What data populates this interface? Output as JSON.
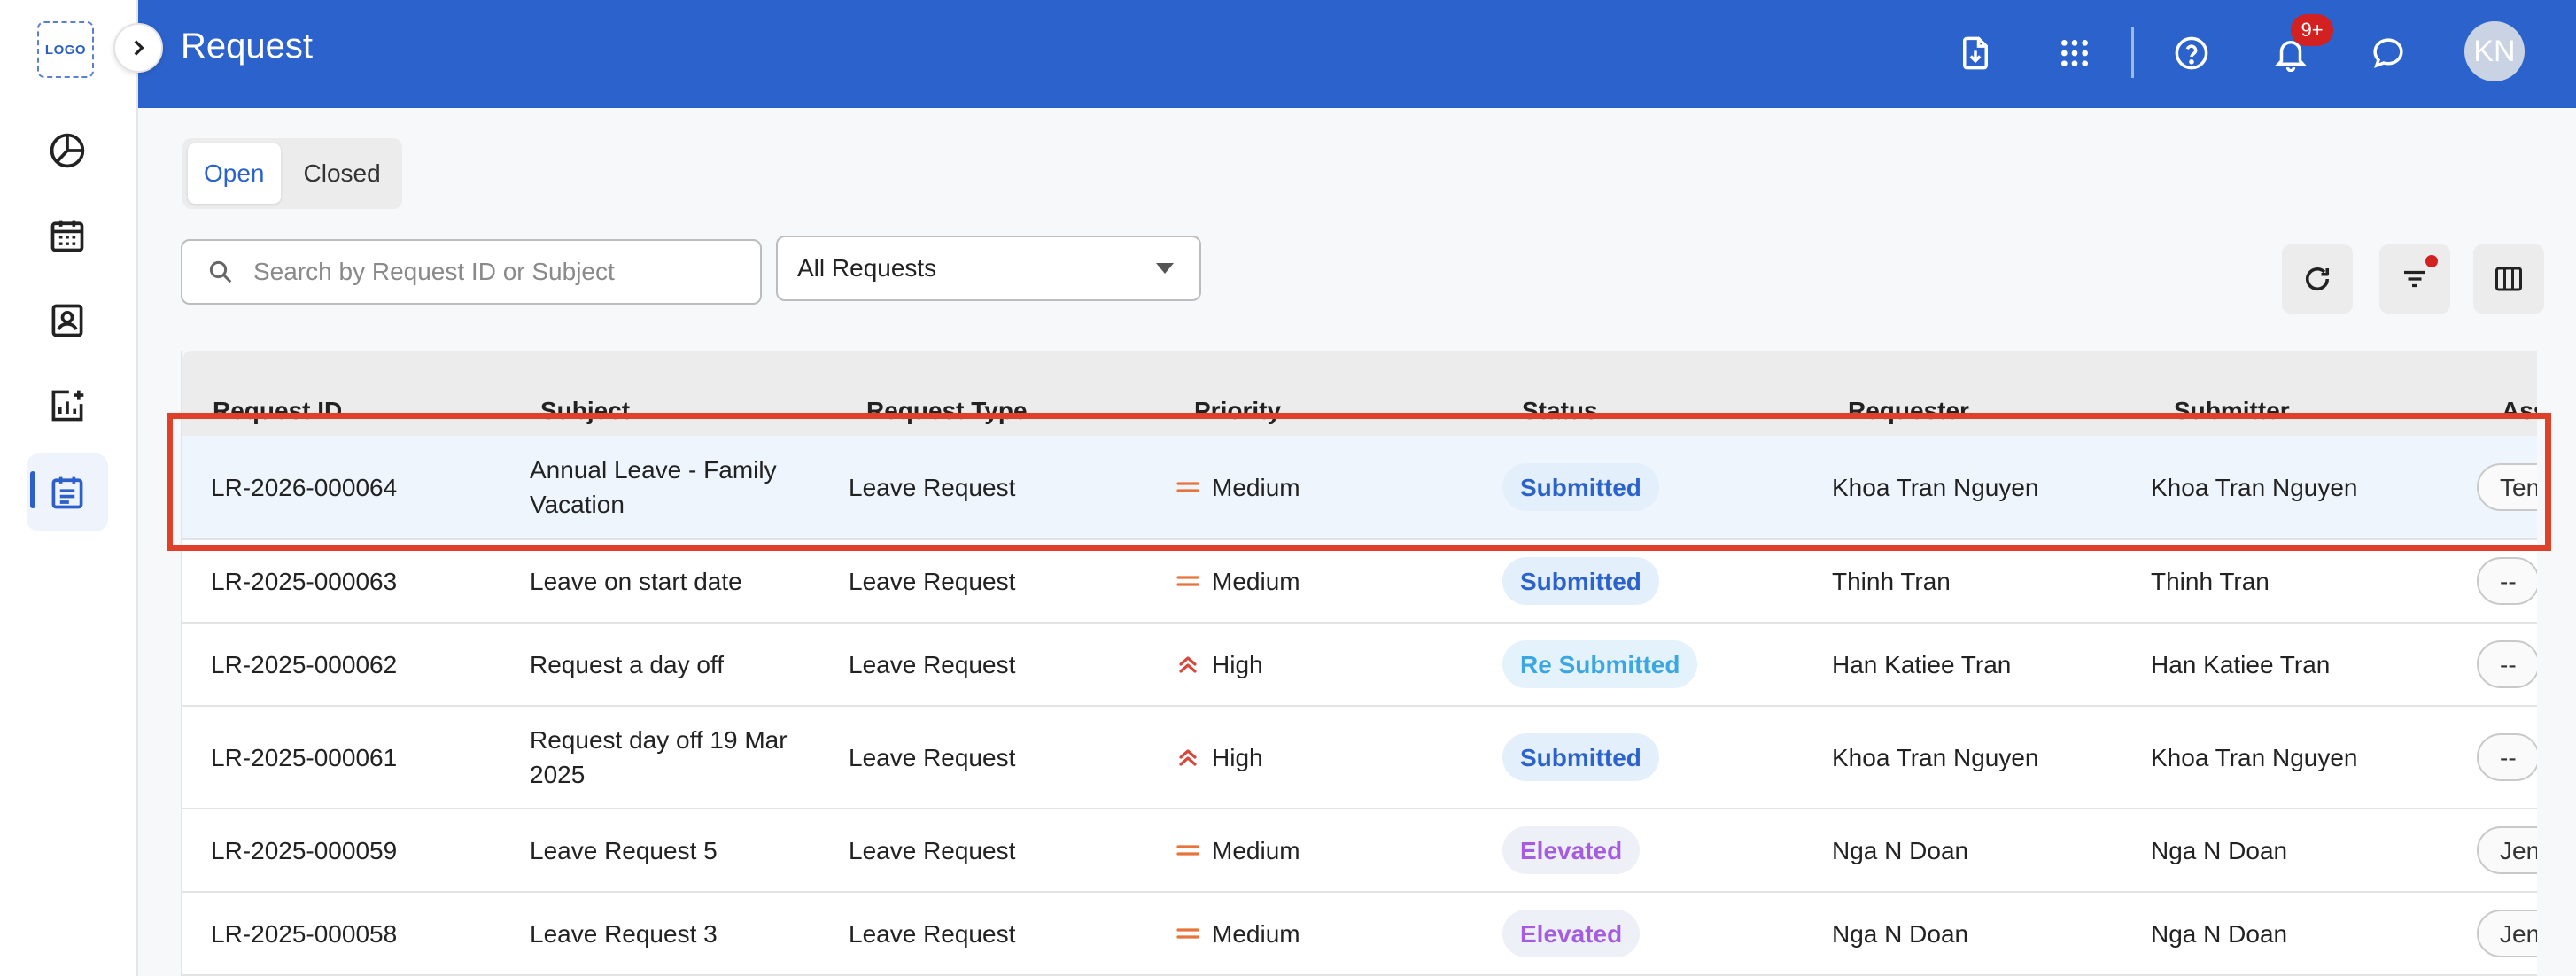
{
  "sidebar": {
    "logo": "LOGO",
    "items": [
      {
        "icon": "pie-chart-icon"
      },
      {
        "icon": "calendar-icon"
      },
      {
        "icon": "contact-card-icon"
      },
      {
        "icon": "analytics-add-icon"
      },
      {
        "icon": "requests-icon",
        "active": true
      }
    ]
  },
  "header": {
    "title": "Request",
    "notifications_badge": "9+",
    "avatar_initials": "KN"
  },
  "tabs": [
    {
      "label": "Open",
      "active": true
    },
    {
      "label": "Closed",
      "active": false
    }
  ],
  "search": {
    "placeholder": "Search by Request ID or Subject",
    "value": ""
  },
  "filter_select": {
    "value": "All Requests"
  },
  "table": {
    "columns": [
      "Request ID",
      "Subject",
      "Request Type",
      "Priority",
      "Status",
      "Requester",
      "Submitter",
      "Assignee"
    ],
    "rows": [
      {
        "id": "LR-2026-000064",
        "subject": "Annual Leave - Family Vacation",
        "type": "Leave Request",
        "priority": "Medium",
        "status": "Submitted",
        "requester": "Khoa Tran Nguyen",
        "submitter": "Khoa Tran Nguyen",
        "assignee": "Tenant"
      },
      {
        "id": "LR-2025-000063",
        "subject": "Leave on start date",
        "type": "Leave Request",
        "priority": "Medium",
        "status": "Submitted",
        "requester": "Thinh Tran",
        "submitter": "Thinh Tran",
        "assignee": "--"
      },
      {
        "id": "LR-2025-000062",
        "subject": "Request a day off",
        "type": "Leave Request",
        "priority": "High",
        "status": "Re Submitted",
        "requester": "Han Katiee Tran",
        "submitter": "Han Katiee Tran",
        "assignee": "--"
      },
      {
        "id": "LR-2025-000061",
        "subject": "Request day off 19 Mar 2025",
        "type": "Leave Request",
        "priority": "High",
        "status": "Submitted",
        "requester": "Khoa Tran Nguyen",
        "submitter": "Khoa Tran Nguyen",
        "assignee": "--"
      },
      {
        "id": "LR-2025-000059",
        "subject": "Leave Request 5",
        "type": "Leave Request",
        "priority": "Medium",
        "status": "Elevated",
        "requester": "Nga N Doan",
        "submitter": "Nga N Doan",
        "assignee": "Jennie"
      },
      {
        "id": "LR-2025-000058",
        "subject": "Leave Request 3",
        "type": "Leave Request",
        "priority": "Medium",
        "status": "Elevated",
        "requester": "Nga N Doan",
        "submitter": "Nga N Doan",
        "assignee": "Jennie"
      }
    ]
  },
  "colors": {
    "header_bg": "#2c62cc",
    "highlight_border": "#e0402a",
    "priority_medium": "#e8743b",
    "priority_high": "#d9473a",
    "status_submitted_fg": "#2c62cc",
    "status_submitted_bg": "#e3effb",
    "status_resubmitted_fg": "#3ba6e0",
    "status_resubmitted_bg": "#e3f2fb",
    "status_elevated_fg": "#a45de0",
    "status_elevated_bg": "#eef0f8"
  }
}
